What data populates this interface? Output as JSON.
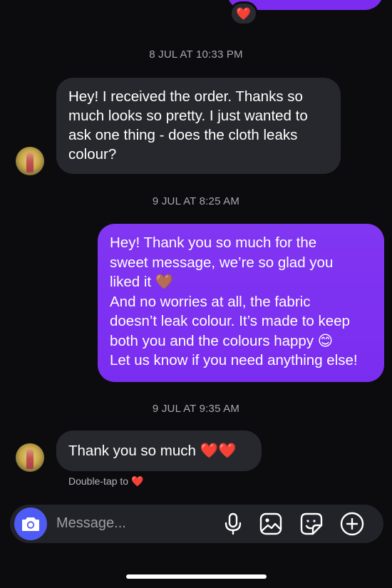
{
  "thread": {
    "top_reaction": "❤️",
    "timestamps": [
      "8 JUL AT 10:33 PM",
      "9 JUL AT 8:25 AM",
      "9 JUL AT 9:35 AM"
    ],
    "messages": [
      {
        "direction": "incoming",
        "lines": [
          "Hey! I received the order. Thanks so",
          "much looks so pretty. I just wanted to",
          "ask one thing - does the cloth leaks",
          "colour?"
        ]
      },
      {
        "direction": "outgoing",
        "lines": [
          "Hey! Thank you so much for the",
          "sweet message, we’re so glad you",
          "liked it 🤎",
          "And no worries at all, the fabric",
          "doesn’t leak colour. It’s made to keep",
          "both you and the colours happy 😊",
          "Let us know if you need anything else!"
        ]
      },
      {
        "direction": "incoming",
        "lines": [
          "Thank you so much ❤️❤️"
        ]
      }
    ],
    "double_tap_hint": "Double-tap to",
    "double_tap_icon": "❤️"
  },
  "composer": {
    "placeholder": "Message...",
    "icons": [
      "camera-icon",
      "microphone-icon",
      "image-icon",
      "sticker-icon",
      "plus-icon"
    ]
  },
  "colors": {
    "background": "#0c0c0f",
    "incoming_bubble": "#27282d",
    "outgoing_bubble": "#7b2ff1",
    "camera_button": "#4e5bf5"
  }
}
